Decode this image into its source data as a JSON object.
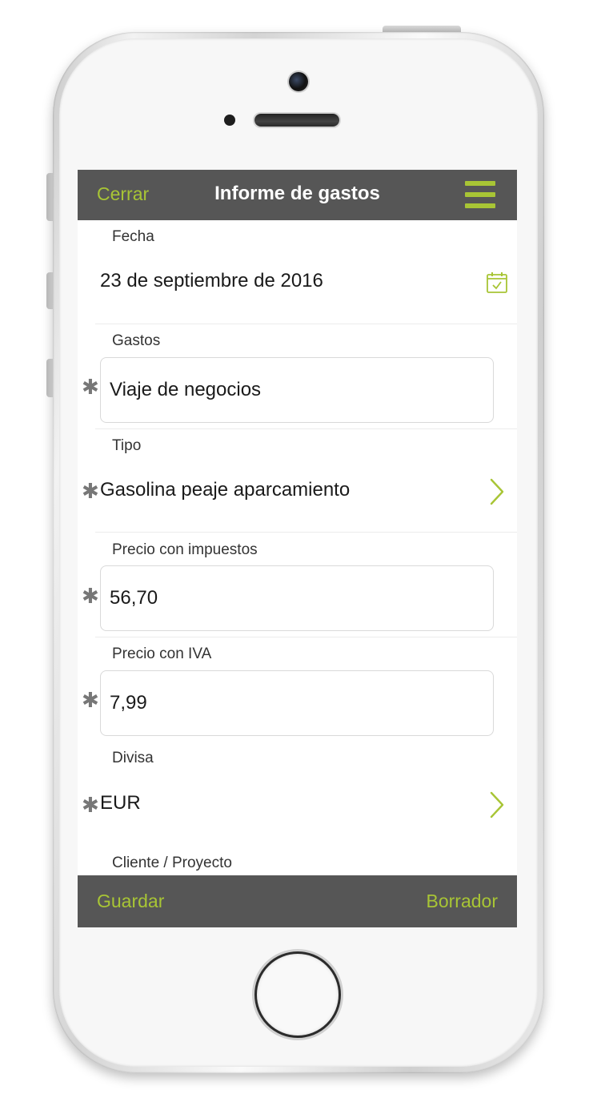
{
  "colors": {
    "accent": "#a8c535",
    "bar_background": "#565656",
    "title_text": "#ffffff"
  },
  "header": {
    "close_label": "Cerrar",
    "title": "Informe de gastos",
    "menu_icon": "hamburger-menu-icon"
  },
  "form": {
    "date": {
      "label": "Fecha",
      "value": "23 de septiembre de 2016",
      "icon": "calendar-icon"
    },
    "expense": {
      "label": "Gastos",
      "value": "Viaje de negocios",
      "required_mark": "✱"
    },
    "type": {
      "label": "Tipo",
      "value": "Gasolina peaje aparcamiento",
      "required_mark": "✱",
      "icon": "chevron-right-icon"
    },
    "price_with_tax": {
      "label": "Precio con impuestos",
      "value": "56,70",
      "required_mark": "✱"
    },
    "price_with_vat": {
      "label": "Precio con IVA",
      "value": "7,99",
      "required_mark": "✱"
    },
    "currency": {
      "label": "Divisa",
      "value": "EUR",
      "required_mark": "✱",
      "icon": "chevron-right-icon"
    },
    "client_project": {
      "label": "Cliente / Proyecto"
    }
  },
  "footer": {
    "save_label": "Guardar",
    "draft_label": "Borrador"
  }
}
